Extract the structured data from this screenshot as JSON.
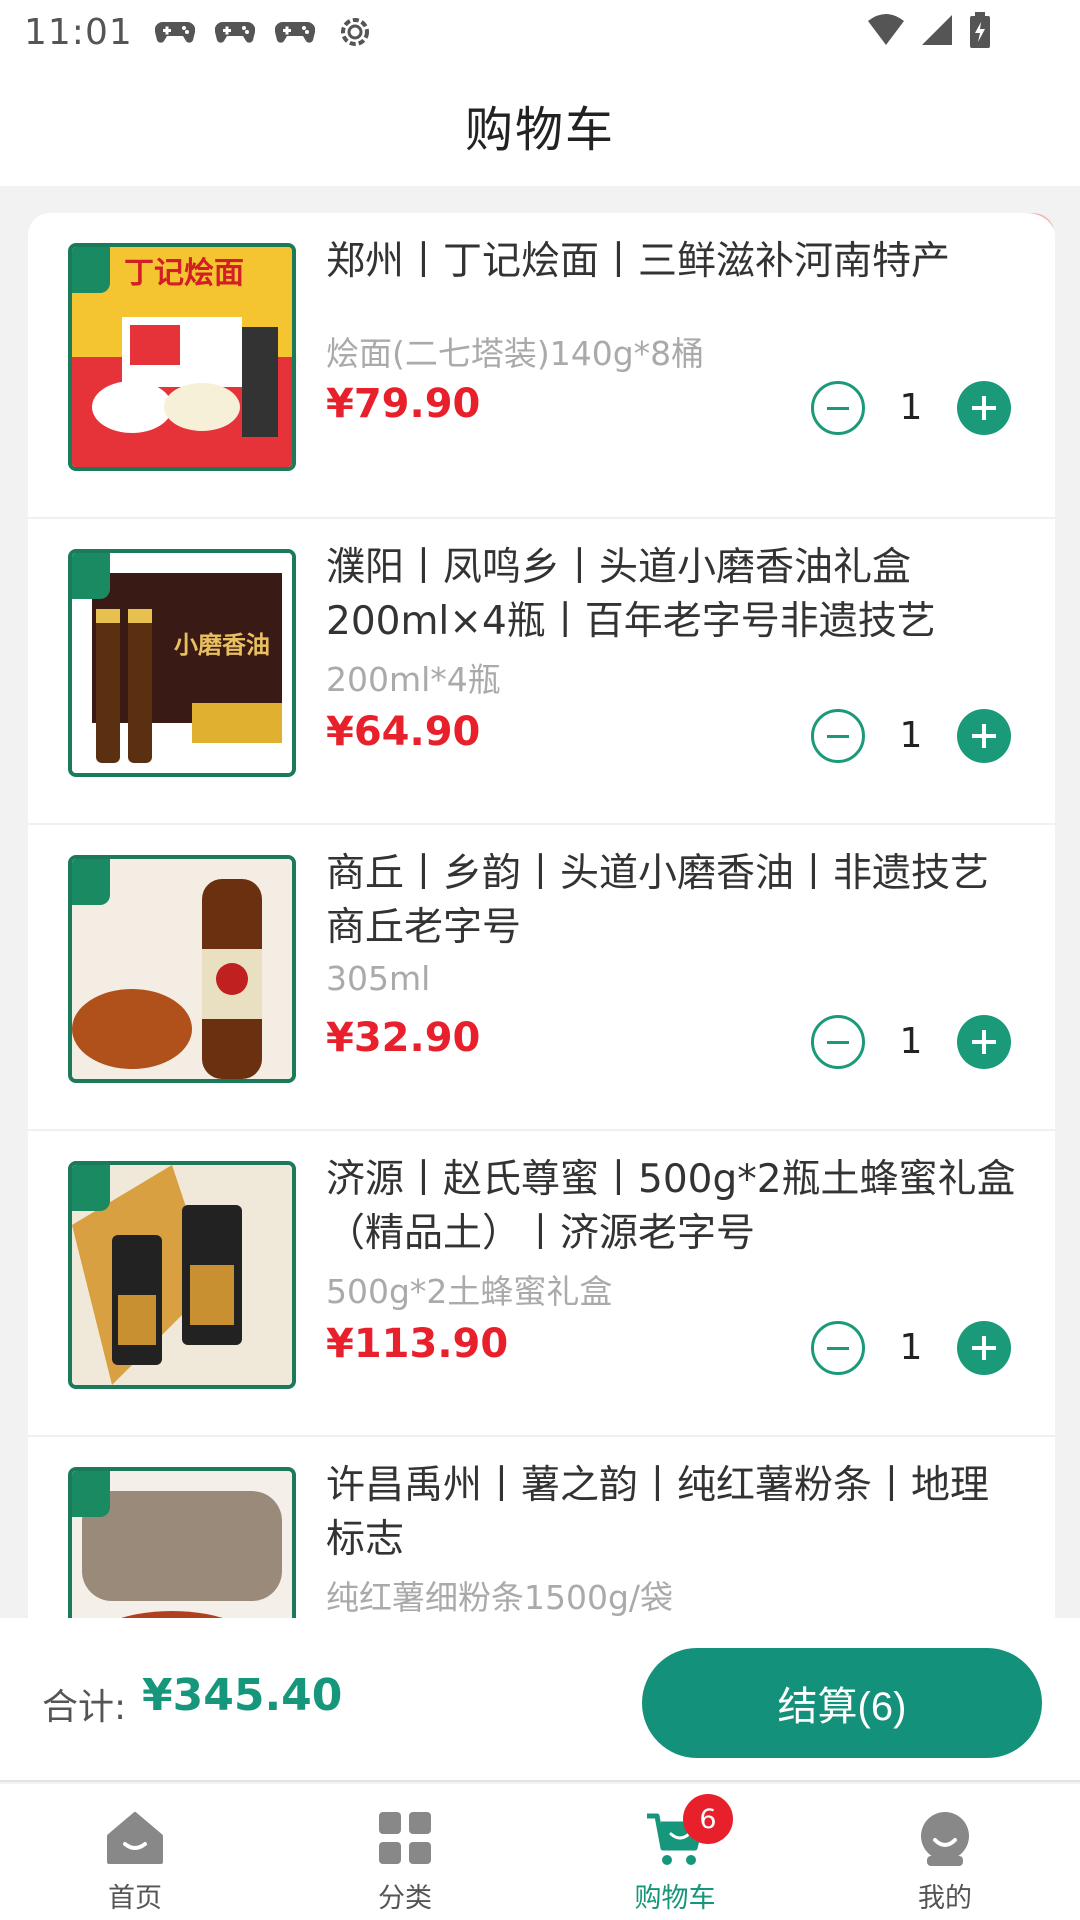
{
  "status_bar": {
    "time": "11:01",
    "icons": [
      "gamepad-icon",
      "gamepad-icon",
      "gamepad-icon",
      "settings-gear-icon"
    ],
    "right_icons": [
      "wifi-icon",
      "signal-icon",
      "battery-icon"
    ]
  },
  "header": {
    "title": "购物车"
  },
  "cart": {
    "items": [
      {
        "title": "郑州丨丁记烩面丨三鲜滋补河南特产",
        "spec": "烩面(二七塔装)140g*8桶",
        "price": "¥79.90",
        "qty": "1",
        "image_text": "丁记烩面"
      },
      {
        "title": "濮阳丨凤鸣乡丨头道小磨香油礼盒200ml×4瓶丨百年老字号非遗技艺",
        "spec": "200ml*4瓶",
        "price": "¥64.90",
        "qty": "1",
        "image_text": "小磨香油"
      },
      {
        "title": "商丘丨乡韵丨头道小磨香油丨非遗技艺商丘老字号",
        "spec": "305ml",
        "price": "¥32.90",
        "qty": "1",
        "image_text": ""
      },
      {
        "title": "济源丨赵氏尊蜜丨500g*2瓶土蜂蜜礼盒（精品土）丨济源老字号",
        "spec": "500g*2土蜂蜜礼盒",
        "price": "¥113.90",
        "qty": "1",
        "image_text": ""
      },
      {
        "title": "许昌禹州丨薯之韵丨纯红薯粉条丨地理标志",
        "spec": "纯红薯细粉条1500g/袋",
        "price": "",
        "qty": "",
        "image_text": ""
      }
    ]
  },
  "checkout": {
    "total_label": "合计:",
    "total_value": "¥345.40",
    "button_label": "结算(6)"
  },
  "tabbar": {
    "tabs": [
      {
        "label": "首页",
        "icon": "home-icon"
      },
      {
        "label": "分类",
        "icon": "category-grid-icon"
      },
      {
        "label": "购物车",
        "icon": "cart-icon",
        "badge": "6"
      },
      {
        "label": "我的",
        "icon": "profile-icon"
      }
    ]
  },
  "colors": {
    "accent": "#14917a",
    "price": "#e8202c",
    "badge": "#e8202c"
  }
}
